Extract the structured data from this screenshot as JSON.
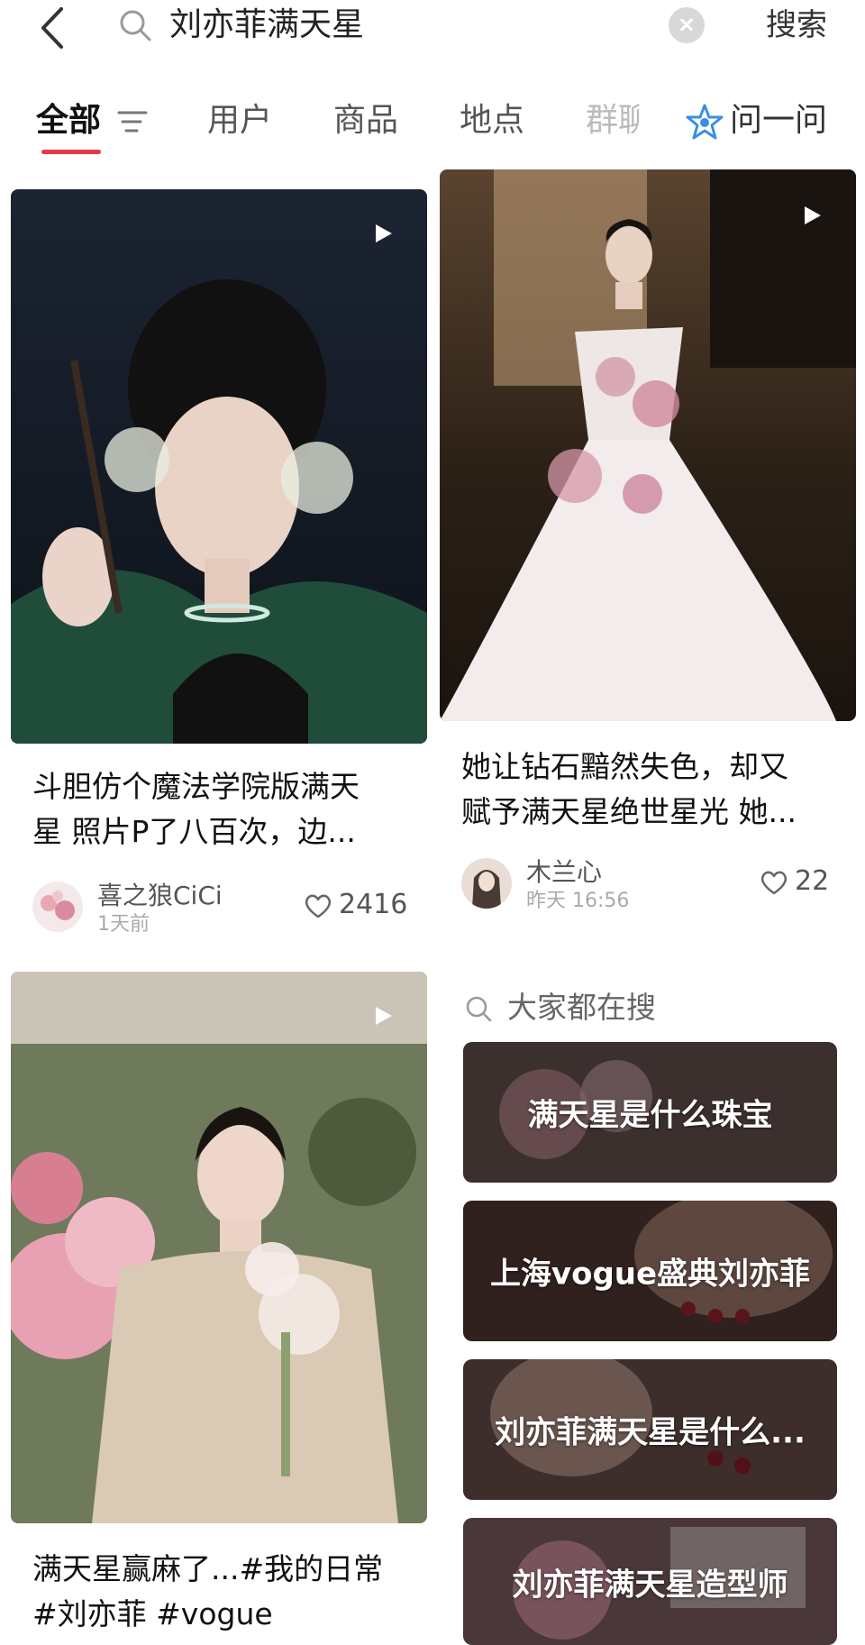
{
  "header": {
    "search_query": "刘亦菲满天星",
    "search_button": "搜索"
  },
  "tabs": {
    "items": [
      "全部",
      "用户",
      "商品",
      "地点",
      "群聊"
    ],
    "ask_label": "问一问"
  },
  "cards": [
    {
      "title_line1": "斗胆仿个魔法学院版满天",
      "title_line2": "星 照片P了八百次，边...",
      "author": "喜之狼CiCi",
      "time": "1天前",
      "likes": "2416",
      "is_video": true
    },
    {
      "title_line1": "她让钻石黯然失色，却又",
      "title_line2": "赋予满天星绝世星光 她...",
      "author": "木兰心",
      "time": "昨天 16:56",
      "likes": "22",
      "is_video": true
    },
    {
      "title_line1": "满天星赢麻了...#我的日常",
      "title_line2": "#刘亦菲 #vogue",
      "is_video": true
    }
  ],
  "trending": {
    "heading": "大家都在搜",
    "items": [
      "满天星是什么珠宝",
      "上海vogue盛典刘亦菲",
      "刘亦菲满天星是什么...",
      "刘亦菲满天星造型师"
    ]
  },
  "colors": {
    "accent": "#e53946",
    "ask_icon": "#3a8ee6"
  },
  "icons": [
    "back-arrow-icon",
    "search-icon",
    "clear-icon",
    "filter-icon",
    "ask-star-icon",
    "play-icon",
    "heart-icon"
  ]
}
